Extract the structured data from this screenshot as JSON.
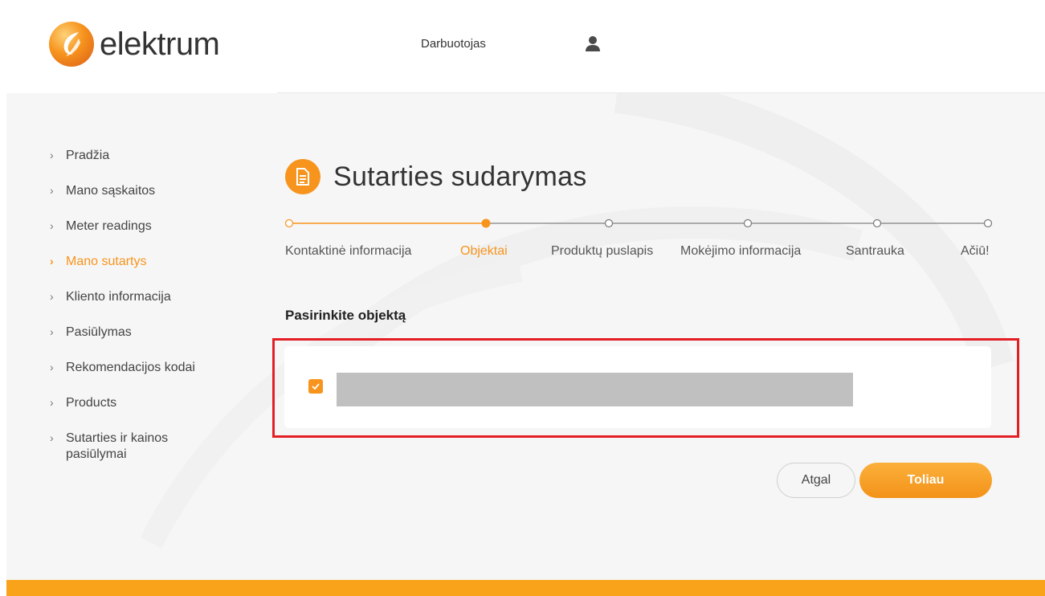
{
  "header": {
    "logo_text": "elektrum",
    "nav_user_label": "Darbuotojas",
    "user_icon": "user-icon"
  },
  "sidebar": {
    "items": [
      {
        "label": "Pradžia",
        "active": false
      },
      {
        "label": "Mano sąskaitos",
        "active": false
      },
      {
        "label": "Meter readings",
        "active": false
      },
      {
        "label": "Mano sutartys",
        "active": true
      },
      {
        "label": "Kliento informacija",
        "active": false
      },
      {
        "label": "Pasiūlymas",
        "active": false
      },
      {
        "label": "Rekomendacijos kodai",
        "active": false
      },
      {
        "label": "Products",
        "active": false
      },
      {
        "label": "Sutarties ir kainos pasiūlymai",
        "active": false
      }
    ]
  },
  "main": {
    "title": "Sutarties sudarymas",
    "title_icon": "document-icon",
    "steps": [
      {
        "label": "Kontaktinė informacija",
        "state": "done"
      },
      {
        "label": "Objektai",
        "state": "current"
      },
      {
        "label": "Produktų puslapis",
        "state": "pending"
      },
      {
        "label": "Mokėjimo informacija",
        "state": "pending"
      },
      {
        "label": "Santrauka",
        "state": "pending"
      },
      {
        "label": "Ačiū!",
        "state": "pending"
      }
    ],
    "section_label": "Pasirinkite objektą",
    "object": {
      "checked": true
    },
    "back_label": "Atgal",
    "next_label": "Toliau"
  },
  "colors": {
    "accent": "#f7941d",
    "highlight": "#e31e24",
    "footer": "#f9a31b"
  }
}
